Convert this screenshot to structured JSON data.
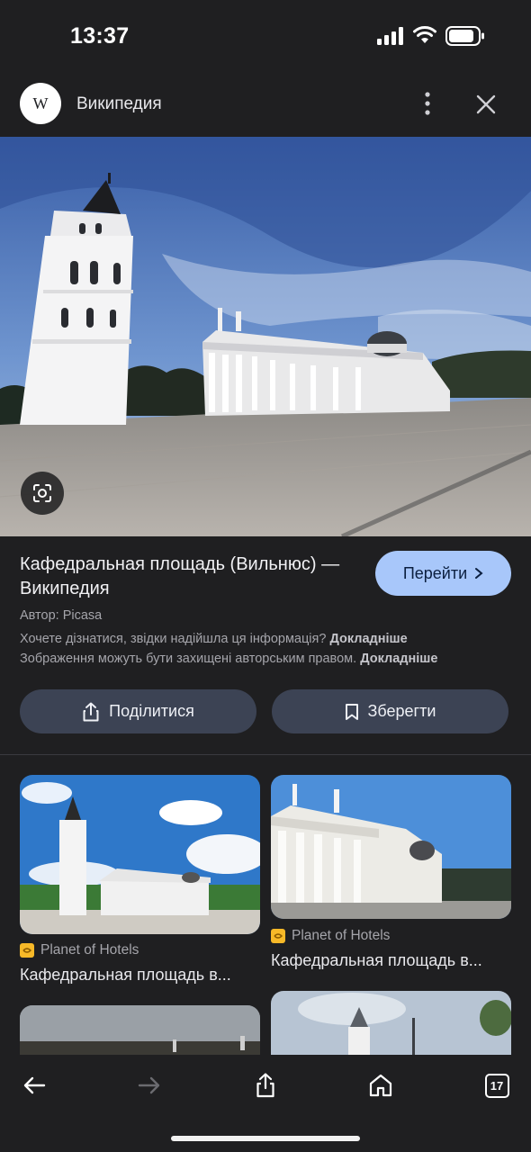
{
  "status": {
    "time": "13:37"
  },
  "header": {
    "avatar_letter": "W",
    "source_name": "Википедия"
  },
  "result": {
    "title": "Кафедральная площадь (Вильнюс) — Википедия",
    "visit_label": "Перейти",
    "author": "Автор: Picasa",
    "info_question": "Хочете дізнатися, звідки надійшла ця інформація?",
    "info_link": "Докладніше",
    "copyright_text": "Зображення можуть бути захищені авторським правом.",
    "copyright_link": "Докладніше",
    "share_label": "Поділитися",
    "save_label": "Зберегти"
  },
  "related": [
    {
      "source": "Planet of Hotels",
      "title": "Кафедральная площадь в..."
    },
    {
      "source": "Planet of Hotels",
      "title": "Кафедральная площадь в..."
    }
  ],
  "nav": {
    "tabs_count": "17"
  },
  "colors": {
    "background": "#1f1f21",
    "accent": "#a8c7fa",
    "button": "#3c4354"
  }
}
